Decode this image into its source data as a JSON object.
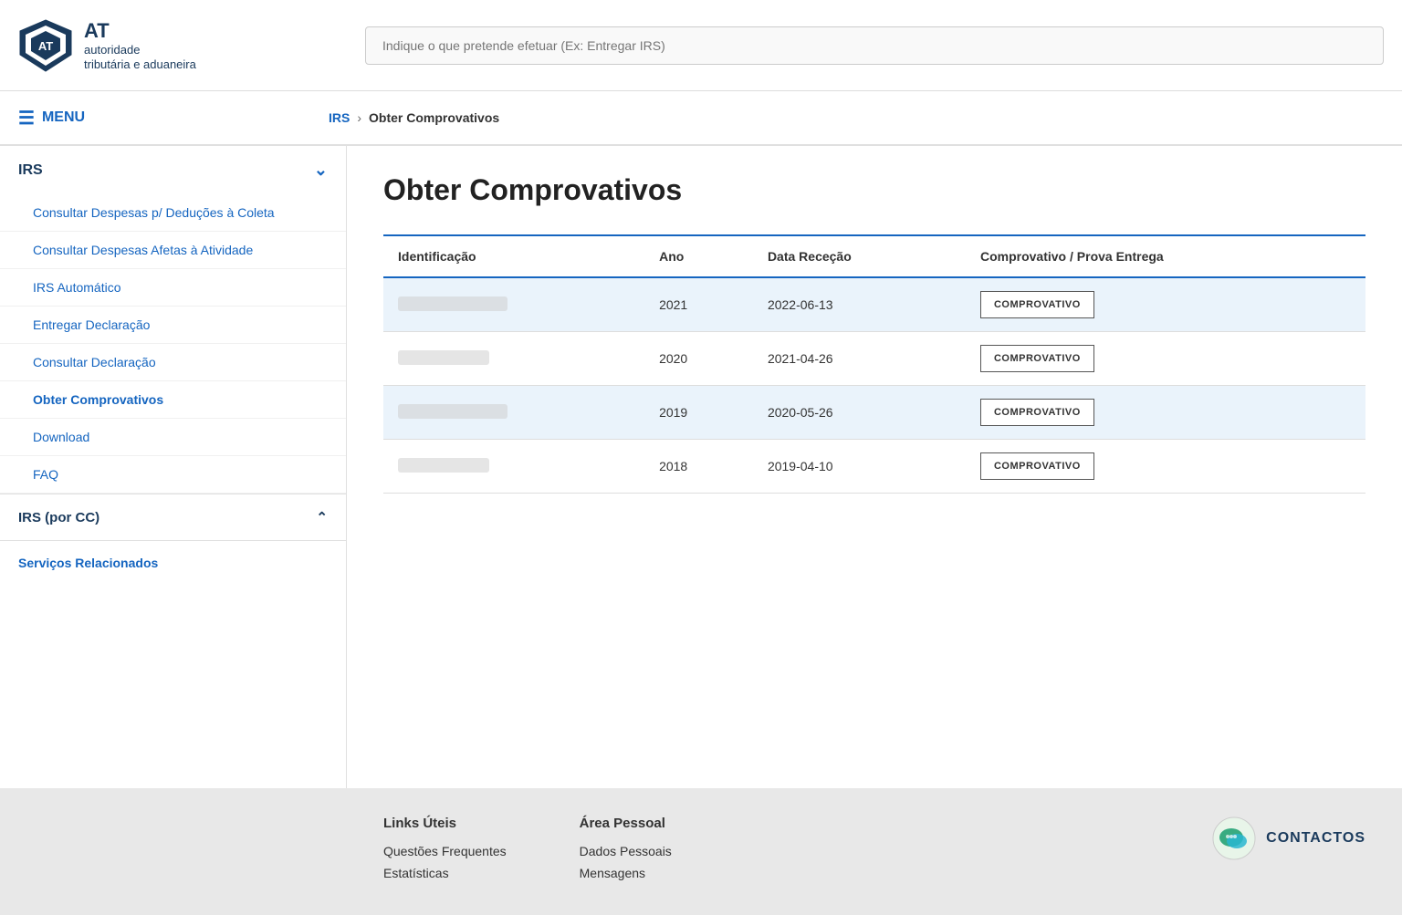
{
  "header": {
    "logo_at": "AT",
    "logo_sub1": "autoridade",
    "logo_sub2": "tributária e aduaneira",
    "search_placeholder": "Indique o que pretende efetuar (Ex: Entregar IRS)"
  },
  "nav": {
    "menu_label": "MENU",
    "breadcrumb_parent": "IRS",
    "breadcrumb_current": "Obter Comprovativos"
  },
  "sidebar": {
    "irs_label": "IRS",
    "items": [
      {
        "label": "Consultar Despesas p/ Deduções à Coleta",
        "active": false
      },
      {
        "label": "Consultar Despesas Afetas à Atividade",
        "active": false
      },
      {
        "label": "IRS Automático",
        "active": false
      },
      {
        "label": "Entregar Declaração",
        "active": false
      },
      {
        "label": "Consultar Declaração",
        "active": false
      },
      {
        "label": "Obter Comprovativos",
        "active": true
      },
      {
        "label": "Download",
        "active": false
      },
      {
        "label": "FAQ",
        "active": false
      }
    ],
    "irs_por_cc_label": "IRS (por CC)",
    "servicos_label": "Serviços Relacionados"
  },
  "main": {
    "title": "Obter Comprovativos",
    "table": {
      "headers": [
        "Identificação",
        "Ano",
        "Data Receção",
        "Comprovativo / Prova Entrega"
      ],
      "rows": [
        {
          "ano": "2021",
          "data": "2022-06-13",
          "btn": "COMPROVATIVO"
        },
        {
          "ano": "2020",
          "data": "2021-04-26",
          "btn": "COMPROVATIVO"
        },
        {
          "ano": "2019",
          "data": "2020-05-26",
          "btn": "COMPROVATIVO"
        },
        {
          "ano": "2018",
          "data": "2019-04-10",
          "btn": "COMPROVATIVO"
        }
      ]
    }
  },
  "footer": {
    "links_uteis": {
      "title": "Links Úteis",
      "items": [
        "Questões Frequentes",
        "Estatísticas"
      ]
    },
    "area_pessoal": {
      "title": "Área Pessoal",
      "items": [
        "Dados Pessoais",
        "Mensagens"
      ]
    },
    "contactos_label": "CONTACTOS"
  }
}
